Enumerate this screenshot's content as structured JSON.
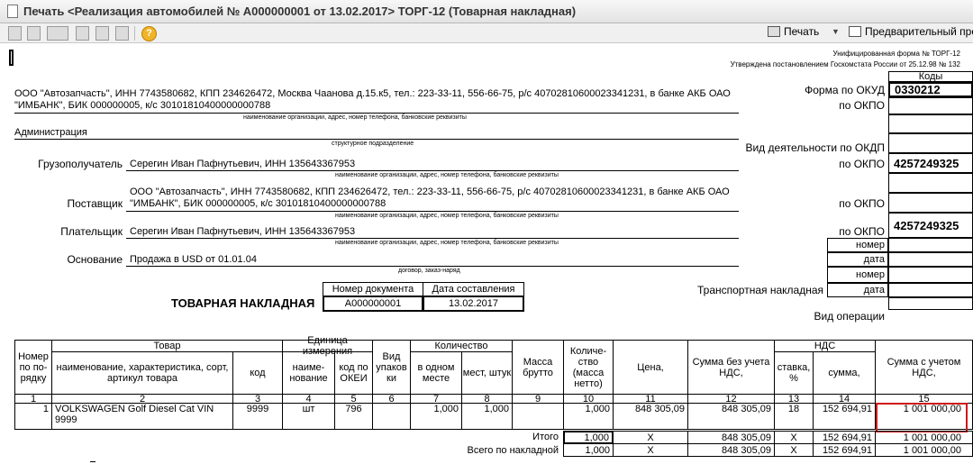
{
  "window": {
    "title": "Печать <Реализация автомобилей № А000000001 от 13.02.2017> ТОРГ-12 (Товарная накладная)"
  },
  "toolbar": {
    "help": "?",
    "print_label": "Печать",
    "preview_label": "Предварительный прос"
  },
  "form_header": {
    "unified": "Унифицированная форма № ТОРГ-12",
    "approved": "Утверждена постановлением Госкомстата России от 25.12.98 № 132",
    "codes": "Коды",
    "okud_label": "Форма по ОКУД",
    "okud": "0330212",
    "okpo_label": "по ОКПО",
    "okdp_label": "Вид деятельности по ОКДП",
    "okpo_consignee": "4257249325",
    "okpo_payer": "4257249325",
    "number_label": "номер",
    "date_label": "дата",
    "transport": "Транспортная накладная",
    "operation": "Вид операции"
  },
  "parties": {
    "org_line1": "ООО \"Автозапчасть\", ИНН 7743580682, КПП 234626472, Москва Чаанова д.15.к5, тел.: 223-33-11, 556-66-75, р/с 40702810600023341231, в банке АКБ ОАО",
    "org_line2": "\"ИМБАНК\", БИК 000000005, к/с 30101810400000000788",
    "org_caption": "наименование организации, адрес, номер телефона, банковские реквизиты",
    "division": "Администрация",
    "division_caption": "структурное подразделение",
    "consignee_label": "Грузополучатель",
    "consignee": "Серегин Иван Пафнутьевич, ИНН 135643367953",
    "supplier_label": "Поставщик",
    "supplier_line1": "ООО \"Автозапчасть\", ИНН 7743580682, КПП 234626472, тел.: 223-33-11, 556-66-75, р/с 40702810600023341231, в банке АКБ ОАО",
    "supplier_line2": "\"ИМБАНК\", БИК 000000005, к/с 30101810400000000788",
    "payer_label": "Плательщик",
    "payer": "Серегин Иван Пафнутьевич, ИНН 135643367953",
    "basis_label": "Основание",
    "basis": "Продажа в USD от 01.01.04",
    "basis_caption": "договор, заказ-наряд"
  },
  "invoice": {
    "title": "ТОВАРНАЯ НАКЛАДНАЯ",
    "docnum_header": "Номер документа",
    "date_header": "Дата составления",
    "docnum": "А000000001",
    "date": "13.02.2017"
  },
  "table": {
    "h_num": "Номер по по- рядку",
    "h_goods": "Товар",
    "h_goods_name": "наименование, характеристика, сорт, артикул товара",
    "h_code": "код",
    "h_unit": "Единица измерения",
    "h_unit_name": "наиме- нование",
    "h_unit_okei": "код по ОКЕИ",
    "h_pack": "Вид упаков ки",
    "h_qty": "Количество",
    "h_qty_one": "в одном месте",
    "h_qty_places": "мест, штук",
    "h_gross": "Масса брутто",
    "h_net": "Количе- ство (масса нетто)",
    "h_price": "Цена,",
    "h_sum_novat": "Сумма без учета НДС,",
    "h_vat": "НДС",
    "h_vat_rate": "ставка, %",
    "h_vat_sum": "сумма,",
    "h_total": "Сумма с учетом НДС,",
    "col_numbers": [
      "1",
      "2",
      "3",
      "4",
      "5",
      "6",
      "7",
      "8",
      "9",
      "10",
      "11",
      "12",
      "13",
      "14",
      "15"
    ],
    "row": {
      "num": "1",
      "name": "VOLKSWAGEN Golf Diesel Cat VIN 9999",
      "code": "9999",
      "unit": "шт",
      "okei": "796",
      "qty_one": "1,000",
      "places": "1,000",
      "net": "1,000",
      "price": "848 305,09",
      "sum_novat": "848 305,09",
      "vat_rate": "18",
      "vat_sum": "152 694,91",
      "total": "1 001 000,00"
    },
    "itogo_label": "Итого",
    "itogo": {
      "places": "1,000",
      "net": "1,000",
      "price": "X",
      "sum_novat": "848 305,09",
      "vat_rate": "X",
      "vat_sum": "152 694,91",
      "total": "1 001 000,00"
    },
    "grand_label": "Всего по накладной",
    "grand": {
      "places": "1,000",
      "net": "1,000",
      "price": "X",
      "sum_novat": "848 305,09",
      "vat_rate": "X",
      "vat_sum": "152 694,91",
      "total": "1 001 000,00"
    }
  }
}
